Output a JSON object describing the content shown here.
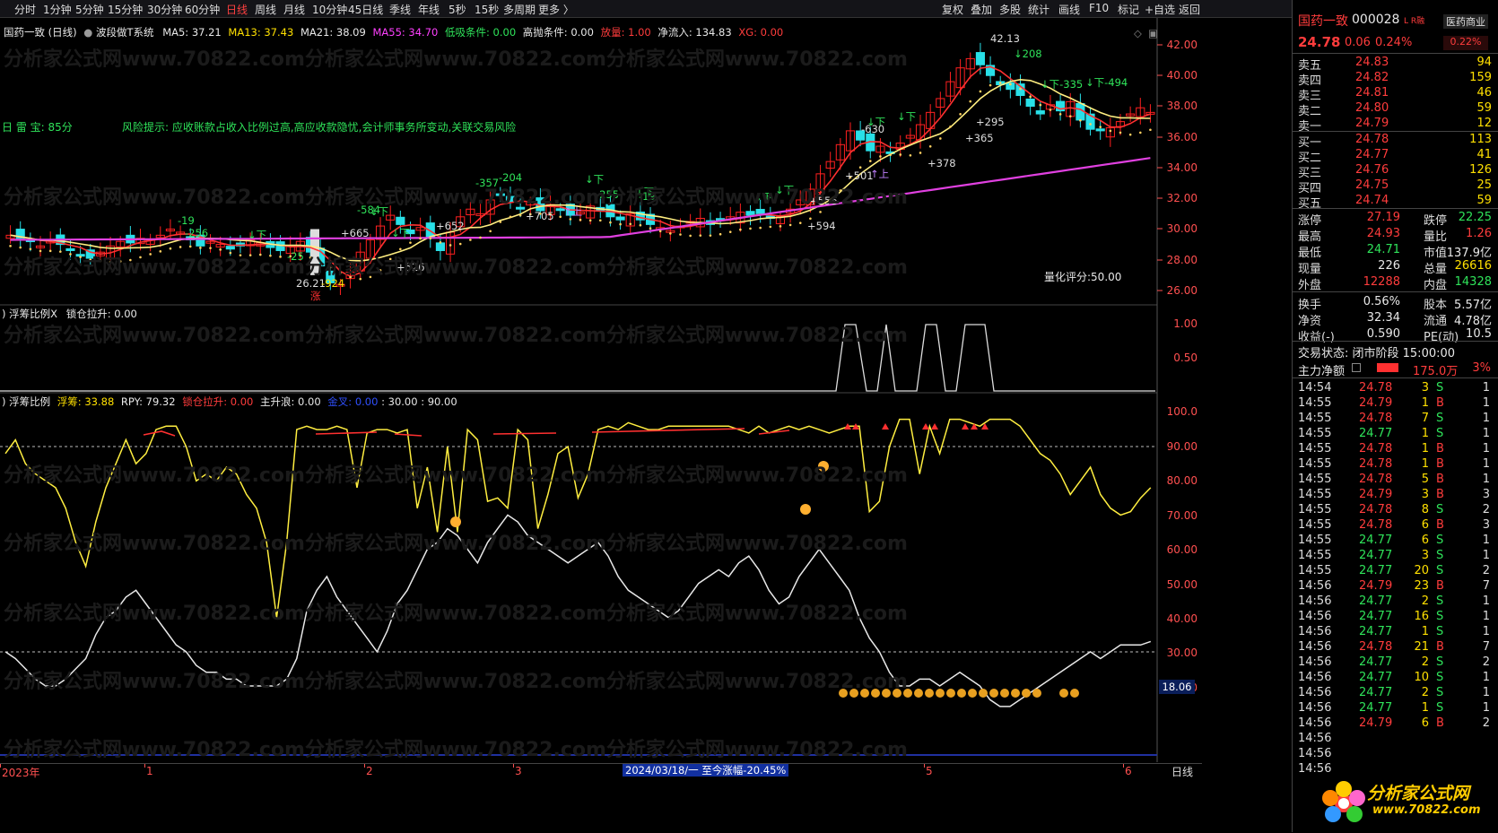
{
  "toolbar": {
    "periods": [
      "分时",
      "1分钟",
      "5分钟",
      "15分钟",
      "30分钟",
      "60分钟",
      "日线",
      "周线",
      "月线",
      "10分钟",
      "45日线",
      "季线",
      "年线",
      "5秒",
      "15秒",
      "多周期",
      "更多 〉"
    ],
    "active": "日线",
    "right": [
      "复权",
      "叠加",
      "多股",
      "统计",
      "画线",
      "F10",
      "标记",
      "+自选",
      "返回"
    ]
  },
  "kline": {
    "title": "国药一致 (日线)",
    "system": "波段做T系统",
    "ma5": "MA5: 37.21",
    "ma13": "MA13: 37.43",
    "ma21": "MA21: 38.09",
    "ma55": "MA55: 34.70",
    "lowsuck": "低吸条件: 0.00",
    "highsell": "高抛条件: 0.00",
    "vol": "放量: 1.00",
    "inflow": "净流入: 134.83",
    "xg": "XG: 0.00",
    "leiquan": "日 雷 宝:   85分",
    "risk": "风险提示:   应收账款占收入比例过高,高应收款隐忧,会计师事务所变动,关联交易风险",
    "score": "量化评分:50.00",
    "yaxis": [
      "42.00",
      "40.00",
      "38.00",
      "36.00",
      "34.00",
      "32.00",
      "30.00",
      "28.00",
      "26.00"
    ],
    "annotations": [
      "42.13",
      "↓208",
      "↓下-335",
      "↓下-494",
      "↓下",
      "↓下",
      "-630",
      "+295",
      "+365",
      "+378",
      "+501",
      "↑上",
      "+556",
      "+594",
      "↓下",
      "↓下",
      "↓下",
      "↓下",
      "-357",
      "-204",
      "-255",
      "-19",
      "+705",
      "↑上",
      "+652",
      "+665",
      "-584",
      "↓下",
      "+526",
      "↓下",
      "-19",
      "-256",
      "↓下",
      "-25",
      "26.21",
      "-924",
      "涨"
    ]
  },
  "ind1": {
    "title": "浮筹比例X",
    "lock": "锁仓拉升: 0.00",
    "yaxis": [
      "1.00",
      "0.50"
    ]
  },
  "ind2": {
    "title": "浮筹比例",
    "float": "浮筹: 33.88",
    "rpy": "RPY: 79.32",
    "lockup": "锁仓拉升: 0.00",
    "wave": "主升浪: 0.00",
    "gold": "金叉: 0.00",
    "v30": ": 30.00",
    "v90": ": 90.00",
    "yaxis": [
      "100.0",
      "90.00",
      "80.00",
      "70.00",
      "60.00",
      "50.00",
      "40.00",
      "30.00",
      "20.00"
    ],
    "cur": "18.06"
  },
  "xaxis": {
    "labels": [
      "2023年",
      "1",
      "2",
      "3",
      "4",
      "5",
      "6"
    ],
    "date": "2024/03/18/一  至今涨幅-20.45%",
    "period": "日线"
  },
  "watermark": "分析家公式网www.70822.com",
  "quote": {
    "name": "国药一致",
    "code": "000028",
    "badge": "L R融",
    "sector": "医药商业",
    "price": "24.78",
    "chg": "0.06",
    "pct": "0.24%",
    "pct2": "0.22%",
    "asks": [
      [
        "卖五",
        "24.83",
        "94"
      ],
      [
        "卖四",
        "24.82",
        "159"
      ],
      [
        "卖三",
        "24.81",
        "46"
      ],
      [
        "卖二",
        "24.80",
        "59"
      ],
      [
        "卖一",
        "24.79",
        "12"
      ]
    ],
    "bids": [
      [
        "买一",
        "24.78",
        "113"
      ],
      [
        "买二",
        "24.77",
        "41"
      ],
      [
        "买三",
        "24.76",
        "126"
      ],
      [
        "买四",
        "24.75",
        "25"
      ],
      [
        "买五",
        "24.74",
        "59"
      ]
    ],
    "stats": [
      [
        "涨停",
        "27.19",
        "跌停",
        "22.25"
      ],
      [
        "最高",
        "24.93",
        "量比",
        "1.26"
      ],
      [
        "最低",
        "24.71",
        "市值",
        "137.9亿"
      ],
      [
        "现量",
        "226",
        "总量",
        "26616"
      ],
      [
        "外盘",
        "12288",
        "内盘",
        "14328"
      ],
      [
        "换手",
        "0.56%",
        "股本",
        "5.57亿"
      ],
      [
        "净资",
        "32.34",
        "流通",
        "4.78亿"
      ],
      [
        "收益(-)",
        "0.590",
        "PE(动)",
        "10.5"
      ]
    ],
    "status": "交易状态: 闭市阶段 15:00:00",
    "mainflow": "主力净额",
    "mainflow_val": "175.0万",
    "mainflow_pct": "3%",
    "ticks": [
      [
        "14:54",
        "24.78",
        "3",
        "S",
        "1"
      ],
      [
        "14:55",
        "24.79",
        "1",
        "B",
        "1"
      ],
      [
        "14:55",
        "24.78",
        "7",
        "S",
        "1"
      ],
      [
        "14:55",
        "24.77",
        "1",
        "S",
        "1"
      ],
      [
        "14:55",
        "24.78",
        "1",
        "B",
        "1"
      ],
      [
        "14:55",
        "24.78",
        "1",
        "B",
        "1"
      ],
      [
        "14:55",
        "24.78",
        "5",
        "B",
        "1"
      ],
      [
        "14:55",
        "24.79",
        "3",
        "B",
        "3"
      ],
      [
        "14:55",
        "24.78",
        "8",
        "S",
        "2"
      ],
      [
        "14:55",
        "24.78",
        "6",
        "B",
        "3"
      ],
      [
        "14:55",
        "24.77",
        "6",
        "S",
        "1"
      ],
      [
        "14:55",
        "24.77",
        "3",
        "S",
        "1"
      ],
      [
        "14:55",
        "24.77",
        "20",
        "S",
        "2"
      ],
      [
        "14:56",
        "24.79",
        "23",
        "B",
        "7"
      ],
      [
        "14:56",
        "24.77",
        "2",
        "S",
        "1"
      ],
      [
        "14:56",
        "24.77",
        "16",
        "S",
        "1"
      ],
      [
        "14:56",
        "24.77",
        "1",
        "S",
        "1"
      ],
      [
        "14:56",
        "24.78",
        "21",
        "B",
        "7"
      ],
      [
        "14:56",
        "24.77",
        "2",
        "S",
        "2"
      ],
      [
        "14:56",
        "24.77",
        "10",
        "S",
        "1"
      ],
      [
        "14:56",
        "24.77",
        "2",
        "S",
        "1"
      ],
      [
        "14:56",
        "24.77",
        "1",
        "S",
        "1"
      ],
      [
        "14:56",
        "24.79",
        "6",
        "B",
        "2"
      ],
      [
        "14:56",
        "",
        "",
        "",
        ""
      ],
      [
        "14:56",
        "",
        "",
        "",
        ""
      ],
      [
        "14:56",
        "",
        "",
        "",
        ""
      ]
    ]
  },
  "logo": {
    "text": "分析家公式网",
    "url": "www.70822.com"
  }
}
